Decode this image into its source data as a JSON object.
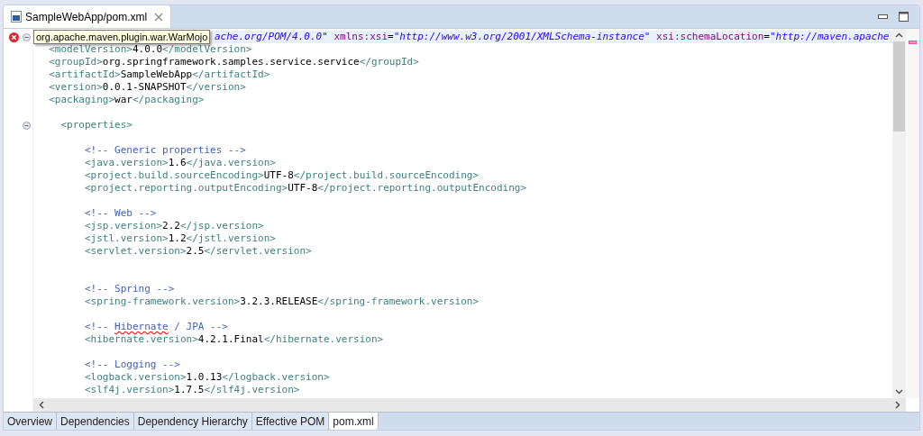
{
  "editor_tab": {
    "title": "SampleWebApp/pom.xml"
  },
  "tooltip": "org.apache.maven.plugin.war.WarMojo",
  "lines": [
    {
      "error": true,
      "fold": true,
      "current": true,
      "hidden_start": true,
      "segments": [
        {
          "kind": "value",
          "text": "ache.org/POM/4.0.0\""
        },
        {
          "kind": "attr",
          "text": " xmlns:xsi"
        },
        {
          "kind": "text",
          "text": "="
        },
        {
          "kind": "value",
          "text": "\"http://www.w3.org/2001/XMLSchema-instance\""
        },
        {
          "kind": "attr",
          "text": " xsi:schemaLocation"
        },
        {
          "kind": "text",
          "text": "="
        },
        {
          "kind": "value",
          "text": "\"http://maven.apache"
        }
      ]
    },
    {
      "segments": [
        {
          "kind": "tag",
          "text": "  <modelVersion>"
        },
        {
          "kind": "text",
          "text": "4.0.0"
        },
        {
          "kind": "tag",
          "text": "</modelVersion>"
        }
      ]
    },
    {
      "segments": [
        {
          "kind": "tag",
          "text": "  <groupId>"
        },
        {
          "kind": "text",
          "text": "org.springframework.samples.service.service"
        },
        {
          "kind": "tag",
          "text": "</groupId>"
        }
      ]
    },
    {
      "segments": [
        {
          "kind": "tag",
          "text": "  <artifactId>"
        },
        {
          "kind": "text",
          "text": "SampleWebApp"
        },
        {
          "kind": "tag",
          "text": "</artifactId>"
        }
      ]
    },
    {
      "segments": [
        {
          "kind": "tag",
          "text": "  <version>"
        },
        {
          "kind": "text",
          "text": "0.0.1-SNAPSHOT"
        },
        {
          "kind": "tag",
          "text": "</version>"
        }
      ]
    },
    {
      "blank_after": true,
      "segments": [
        {
          "kind": "tag",
          "text": "  <packaging>"
        },
        {
          "kind": "text",
          "text": "war"
        },
        {
          "kind": "tag",
          "text": "</packaging>"
        }
      ]
    },
    {
      "fold": true,
      "blank_after": true,
      "segments": [
        {
          "kind": "tag",
          "text": "    <properties>"
        }
      ]
    },
    {
      "segments": [
        {
          "kind": "comment",
          "text": "        <!-- Generic properties -->"
        }
      ]
    },
    {
      "segments": [
        {
          "kind": "tag",
          "text": "        <java.version>"
        },
        {
          "kind": "text",
          "text": "1.6"
        },
        {
          "kind": "tag",
          "text": "</java.version>"
        }
      ]
    },
    {
      "segments": [
        {
          "kind": "tag",
          "text": "        <project.build.sourceEncoding>"
        },
        {
          "kind": "text",
          "text": "UTF-8"
        },
        {
          "kind": "tag",
          "text": "</project.build.sourceEncoding>"
        }
      ]
    },
    {
      "segments": [
        {
          "kind": "tag",
          "text": "        <project.reporting.outputEncoding>"
        },
        {
          "kind": "text",
          "text": "UTF-8"
        },
        {
          "kind": "tag",
          "text": "</project.reporting.outputEncoding>"
        }
      ],
      "blank_after": true
    },
    {
      "segments": [
        {
          "kind": "comment",
          "text": "        <!-- Web -->"
        }
      ]
    },
    {
      "segments": [
        {
          "kind": "tag",
          "text": "        <jsp.version>"
        },
        {
          "kind": "text",
          "text": "2.2"
        },
        {
          "kind": "tag",
          "text": "</jsp.version>"
        }
      ]
    },
    {
      "segments": [
        {
          "kind": "tag",
          "text": "        <jstl.version>"
        },
        {
          "kind": "text",
          "text": "1.2"
        },
        {
          "kind": "tag",
          "text": "</jstl.version>"
        }
      ]
    },
    {
      "segments": [
        {
          "kind": "tag",
          "text": "        <servlet.version>"
        },
        {
          "kind": "text",
          "text": "2.5"
        },
        {
          "kind": "tag",
          "text": "</servlet.version>"
        }
      ],
      "blank_after": true,
      "extra_blank_after": true
    },
    {
      "segments": [
        {
          "kind": "comment",
          "text": "        <!-- Spring -->"
        }
      ]
    },
    {
      "segments": [
        {
          "kind": "tag",
          "text": "        <spring-framework.version>"
        },
        {
          "kind": "text",
          "text": "3.2.3.RELEASE"
        },
        {
          "kind": "tag",
          "text": "</spring-framework.version>"
        }
      ],
      "blank_after": true
    },
    {
      "segments": [
        {
          "kind": "comment",
          "text": "        <!-- "
        },
        {
          "kind": "comment",
          "text": "Hibernate",
          "misspelled": true
        },
        {
          "kind": "comment",
          "text": " / JPA -->"
        }
      ]
    },
    {
      "segments": [
        {
          "kind": "tag",
          "text": "        <hibernate.version>"
        },
        {
          "kind": "text",
          "text": "4.2.1.Final"
        },
        {
          "kind": "tag",
          "text": "</hibernate.version>"
        }
      ],
      "blank_after": true
    },
    {
      "segments": [
        {
          "kind": "comment",
          "text": "        <!-- Logging -->"
        }
      ]
    },
    {
      "segments": [
        {
          "kind": "tag",
          "text": "        <logback.version>"
        },
        {
          "kind": "text",
          "text": "1.0.13"
        },
        {
          "kind": "tag",
          "text": "</logback.version>"
        }
      ]
    },
    {
      "segments": [
        {
          "kind": "tag",
          "text": "        <slf4j.version>"
        },
        {
          "kind": "text",
          "text": "1.7.5"
        },
        {
          "kind": "tag",
          "text": "</slf4j.version>"
        }
      ]
    }
  ],
  "bottom_tabs": [
    {
      "label": "Overview",
      "selected": false
    },
    {
      "label": "Dependencies",
      "selected": false
    },
    {
      "label": "Dependency Hierarchy",
      "selected": false
    },
    {
      "label": "Effective POM",
      "selected": false
    },
    {
      "label": "pom.xml",
      "selected": true
    }
  ]
}
